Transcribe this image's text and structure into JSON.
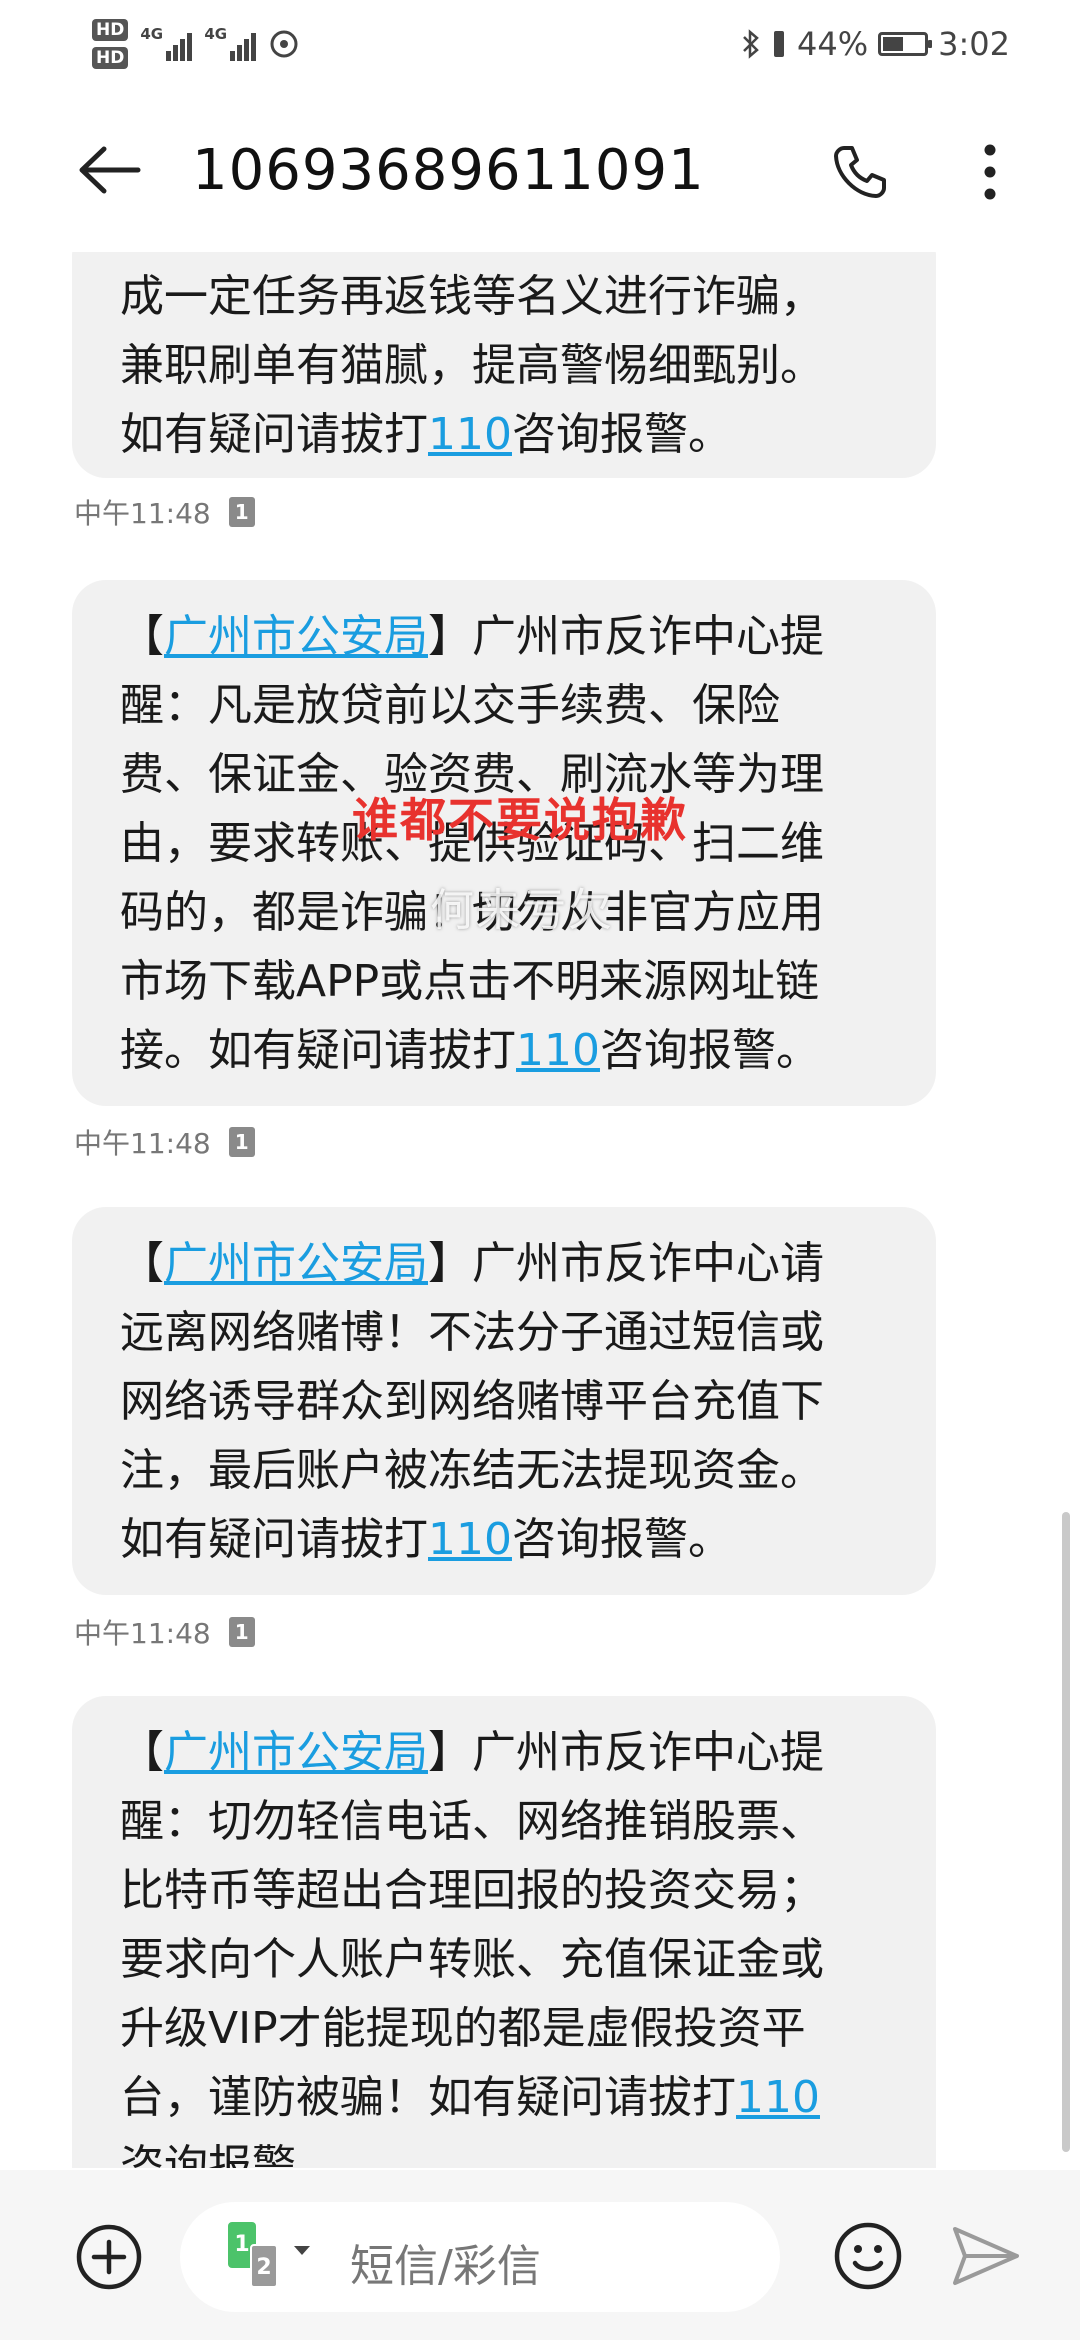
{
  "status_bar": {
    "hd1": "HD",
    "hd2": "HD",
    "net1": "4G",
    "net2": "4G",
    "battery": "44%",
    "battery_level": 0.44,
    "time": "3:02"
  },
  "header": {
    "title": "10693689611091",
    "icons": [
      "back-arrow-icon",
      "phone-icon",
      "more-vert-icon"
    ]
  },
  "messages": [
    {
      "lines": [
        [
          {
            "t": "成一定任务再返钱等名义进行诈骗，"
          }
        ],
        [
          {
            "t": "兼职刷单有猫腻，提高警惕细甄别。"
          }
        ],
        [
          {
            "t": "如有疑问请拔打"
          },
          {
            "t": "110",
            "link": true
          },
          {
            "t": "咨询报警。"
          }
        ]
      ],
      "time": "中午11:48",
      "sim": "1"
    },
    {
      "lines": [
        [
          {
            "t": "【"
          },
          {
            "t": "广州市公安局",
            "link": true
          },
          {
            "t": "】广州市反诈中心提"
          }
        ],
        [
          {
            "t": "醒：凡是放贷前以交手续费、保险"
          }
        ],
        [
          {
            "t": "费、保证金、验资费、刷流水等为理"
          }
        ],
        [
          {
            "t": "由，要求转账、提供验证码、扫二维"
          }
        ],
        [
          {
            "t": "码的，都是诈骗！切勿从非官方应用"
          }
        ],
        [
          {
            "t": "市场下载APP或点击不明来源网址链"
          }
        ],
        [
          {
            "t": "接。如有疑问请拔打"
          },
          {
            "t": "110",
            "link": true
          },
          {
            "t": "咨询报警。"
          }
        ]
      ],
      "time": "中午11:48",
      "sim": "1"
    },
    {
      "lines": [
        [
          {
            "t": "【"
          },
          {
            "t": "广州市公安局",
            "link": true
          },
          {
            "t": "】广州市反诈中心请"
          }
        ],
        [
          {
            "t": "远离网络赌博！不法分子通过短信或"
          }
        ],
        [
          {
            "t": "网络诱导群众到网络赌博平台充值下"
          }
        ],
        [
          {
            "t": "注，最后账户被冻结无法提现资金。"
          }
        ],
        [
          {
            "t": "如有疑问请拔打"
          },
          {
            "t": "110",
            "link": true
          },
          {
            "t": "咨询报警。"
          }
        ]
      ],
      "time": "中午11:48",
      "sim": "1"
    },
    {
      "lines": [
        [
          {
            "t": "【"
          },
          {
            "t": "广州市公安局",
            "link": true
          },
          {
            "t": "】广州市反诈中心提"
          }
        ],
        [
          {
            "t": "醒：切勿轻信电话、网络推销股票、"
          }
        ],
        [
          {
            "t": "比特币等超出合理回报的投资交易；"
          }
        ],
        [
          {
            "t": "要求向个人账户转账、充值保证金或"
          }
        ],
        [
          {
            "t": "升级VIP才能提现的都是虚假投资平"
          }
        ],
        [
          {
            "t": "台，谨防被骗！如有疑问请拔打"
          },
          {
            "t": "110",
            "link": true
          }
        ],
        [
          {
            "t": "咨询报警。"
          }
        ]
      ]
    }
  ],
  "overlays": {
    "red_text": "谁都不要说抱歉",
    "ghost_text": "何来亏欠"
  },
  "compose": {
    "sim_primary": "1",
    "sim_secondary": "2",
    "placeholder": "短信/彩信",
    "icons": [
      "add-icon",
      "emoji-icon",
      "send-icon"
    ]
  },
  "colors": {
    "link": "#1a9de0",
    "bubble": "#f1f1f1",
    "overlay_red": "#e8322e",
    "sim_green": "#4cc36a"
  }
}
